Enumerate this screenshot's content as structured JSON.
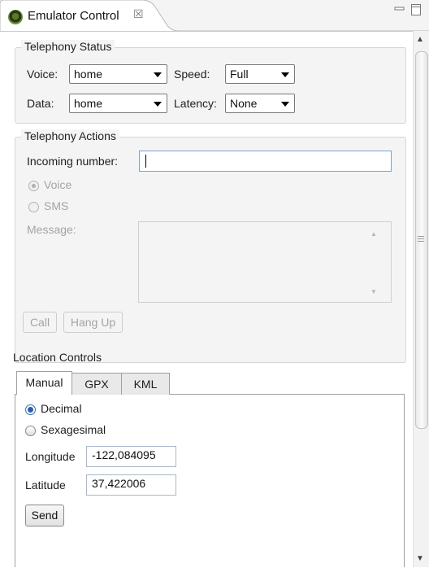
{
  "view": {
    "title": "Emulator Control",
    "close_glyph": "☒",
    "icons": [
      "android-emulator-icon",
      "close-icon",
      "minimize-icon",
      "maximize-icon"
    ]
  },
  "telephony_status": {
    "legend": "Telephony Status",
    "voice_label": "Voice:",
    "voice_value": "home",
    "speed_label": "Speed:",
    "speed_value": "Full",
    "data_label": "Data:",
    "data_value": "home",
    "latency_label": "Latency:",
    "latency_value": "None"
  },
  "telephony_actions": {
    "legend": "Telephony Actions",
    "incoming_label": "Incoming number:",
    "incoming_value": "",
    "voice_option": "Voice",
    "sms_option": "SMS",
    "message_label": "Message:",
    "message_value": "",
    "call_button": "Call",
    "hangup_button": "Hang Up"
  },
  "location": {
    "title": "Location Controls",
    "tabs": [
      "Manual",
      "GPX",
      "KML"
    ],
    "selected_tab": "Manual",
    "decimal_option": "Decimal",
    "sexagesimal_option": "Sexagesimal",
    "selected_format": "Decimal",
    "longitude_label": "Longitude",
    "longitude_value": "-122,084095",
    "latitude_label": "Latitude",
    "latitude_value": "37,422006",
    "send_button": "Send"
  },
  "colors": {
    "panel_bg": "#f4f4f4",
    "accent": "#1f5fbf",
    "disabled_text": "#a4a4a4"
  }
}
